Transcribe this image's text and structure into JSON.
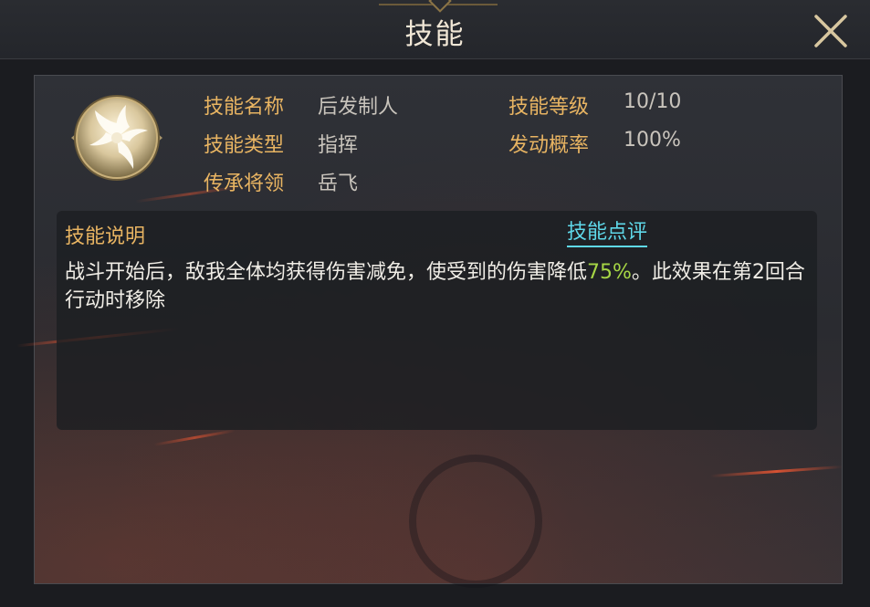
{
  "header": {
    "title": "技能"
  },
  "skill": {
    "fields": {
      "name_label": "技能名称",
      "name_value": "后发制人",
      "type_label": "技能类型",
      "type_value": "指挥",
      "inherit_label": "传承将领",
      "inherit_value": "岳飞",
      "level_label": "技能等级",
      "level_value": "10/10",
      "rate_label": "发动概率",
      "rate_value": "100%"
    },
    "description": {
      "title": "技能说明",
      "review_link": "技能点评",
      "text_before": "战斗开始后，敌我全体均获得伤害减免，使受到的伤害降低",
      "highlight": "75%",
      "text_after": "。此效果在第2回合行动时移除"
    }
  },
  "colors": {
    "label": "#e8b462",
    "value": "#c9c4bc",
    "highlight": "#a6d645",
    "link": "#5fd9ea"
  },
  "icons": {
    "close": "close-icon",
    "skill": "skill-swirl-icon"
  }
}
